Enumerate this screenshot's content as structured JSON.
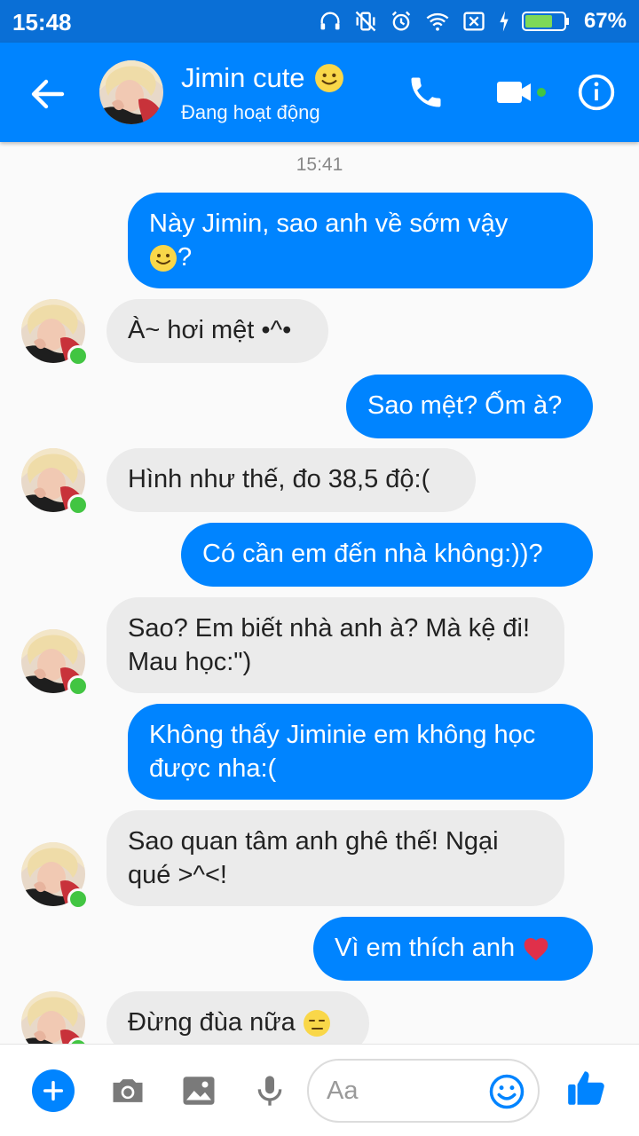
{
  "status_bar": {
    "time": "15:48",
    "battery": "67%"
  },
  "header": {
    "name": "Jimin cute",
    "status": "Đang hoạt động"
  },
  "chat": {
    "timestamp": "15:41",
    "messages": [
      {
        "dir": "out",
        "text": "Này Jimin, sao anh về sớm vậy",
        "text2": "?"
      },
      {
        "dir": "in",
        "text": "À~ hơi mệt •^•"
      },
      {
        "dir": "out",
        "text": "Sao mệt? Ốm à?"
      },
      {
        "dir": "in",
        "text": "Hình như thế, đo 38,5 độ:("
      },
      {
        "dir": "out",
        "text": "Có cần em đến nhà không:))?"
      },
      {
        "dir": "in",
        "text": "Sao? Em biết nhà anh à? Mà kệ đi! Mau học:\")"
      },
      {
        "dir": "out",
        "text": "Không thấy Jiminie em không học được nha:("
      },
      {
        "dir": "in",
        "text": "Sao quan tâm anh ghê thế! Ngại qué >^<!"
      },
      {
        "dir": "out",
        "text": "Vì em thích anh"
      },
      {
        "dir": "in",
        "text": "Đừng đùa nữa"
      }
    ]
  },
  "composer": {
    "placeholder": "Aa"
  },
  "colors": {
    "messenger_blue": "#0084ff",
    "status_bar": "#0a6fd6",
    "incoming_bubble": "#ebebeb",
    "online": "#42c542"
  }
}
